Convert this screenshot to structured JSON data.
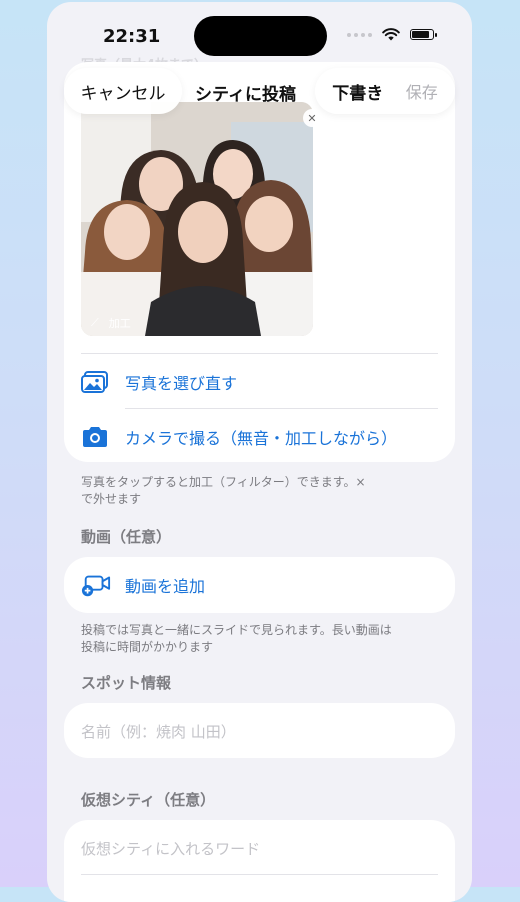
{
  "status": {
    "time": "22:31"
  },
  "nav": {
    "cancel": "キャンセル",
    "title": "シティに投稿",
    "draft": "下書き",
    "save": "保存"
  },
  "ghost_header": "写真（最大4枚まで）",
  "photo": {
    "edit_label": "加工"
  },
  "photo_actions": {
    "reselect": "写真を選び直す",
    "camera": "カメラで撮る（無音・加工しながら）"
  },
  "photo_help": [
    "写真をタップすると加工（フィルター）できます。×",
    "で外せます"
  ],
  "video": {
    "section": "動画（任意）",
    "add": "動画を追加",
    "help": [
      "投稿では写真と一緒にスライドで見られます。長い動画は",
      "投稿に時間がかかります"
    ]
  },
  "spot": {
    "section": "スポット情報",
    "name_placeholder": "名前（例：焼肉 山田）"
  },
  "virtual_city": {
    "section": "仮想シティ（任意）",
    "placeholder": "仮想シティに入れるワード"
  },
  "colors": {
    "accent": "#1a73d8",
    "background": "#f2f2f7"
  }
}
